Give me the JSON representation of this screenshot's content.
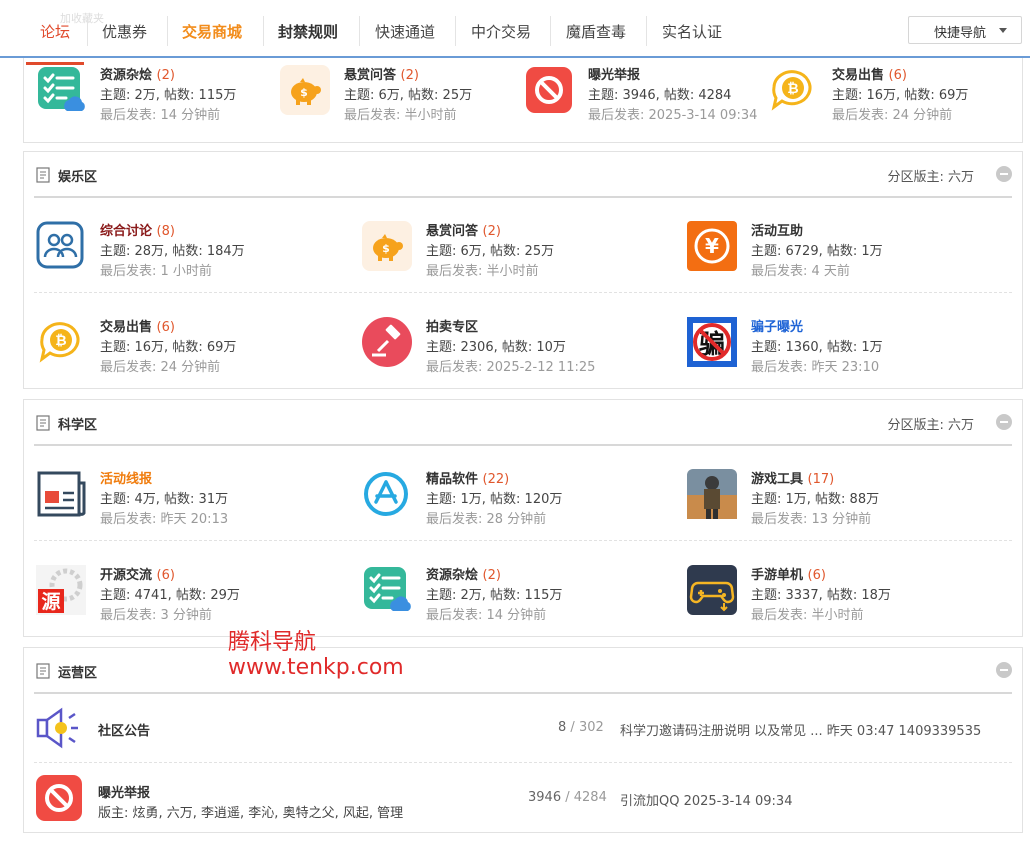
{
  "nav": {
    "hint": "加收藏夹",
    "items": [
      {
        "label": "论坛",
        "style": "active"
      },
      {
        "label": "优惠券",
        "style": ""
      },
      {
        "label": "交易商城",
        "style": "orange"
      },
      {
        "label": "封禁规则",
        "style": "bold"
      },
      {
        "label": "快速通道",
        "style": ""
      },
      {
        "label": "中介交易",
        "style": ""
      },
      {
        "label": "魔盾查毒",
        "style": ""
      },
      {
        "label": "实名认证",
        "style": ""
      }
    ],
    "quick_nav": "快捷导航"
  },
  "top_section": {
    "forums": [
      {
        "name": "资源杂烩",
        "count": "(2)",
        "stats": "主题: 2万, 帖数: 115万",
        "last": "最后发表: 14 分钟前",
        "icon": "checklist-cloud-icon"
      },
      {
        "name": "悬赏问答",
        "count": "(2)",
        "stats": "主题: 6万, 帖数: 25万",
        "last": "最后发表: 半小时前",
        "icon": "piggy-bank-icon"
      },
      {
        "name": "曝光举报",
        "count": "",
        "stats": "主题: 3946, 帖数: 4284",
        "last": "最后发表: 2025-3-14 09:34",
        "icon": "ban-icon"
      },
      {
        "name": "交易出售",
        "count": "(6)",
        "stats": "主题: 16万, 帖数: 69万",
        "last": "最后发表: 24 分钟前",
        "icon": "bitcoin-bubble-icon"
      }
    ]
  },
  "entertainment": {
    "title": "娱乐区",
    "moderator": "分区版主: 六万",
    "forums": [
      {
        "name": "综合讨论",
        "count": "(8)",
        "stats": "主题: 28万, 帖数: 184万",
        "last": "最后发表: 1 小时前",
        "icon": "group-discussion-icon",
        "color": "red"
      },
      {
        "name": "悬赏问答",
        "count": "(2)",
        "stats": "主题: 6万, 帖数: 25万",
        "last": "最后发表: 半小时前",
        "icon": "piggy-bank-icon",
        "color": ""
      },
      {
        "name": "活动互助",
        "count": "",
        "stats": "主题: 6729, 帖数: 1万",
        "last": "最后发表: 4 天前",
        "icon": "yen-coin-icon",
        "color": ""
      },
      {
        "name": "交易出售",
        "count": "(6)",
        "stats": "主题: 16万, 帖数: 69万",
        "last": "最后发表: 24 分钟前",
        "icon": "bitcoin-bubble-icon",
        "color": ""
      },
      {
        "name": "拍卖专区",
        "count": "",
        "stats": "主题: 2306, 帖数: 10万",
        "last": "最后发表: 2025-2-12 11:25",
        "icon": "auction-gavel-icon",
        "color": ""
      },
      {
        "name": "骗子曝光",
        "count": "",
        "stats": "主题: 1360, 帖数: 1万",
        "last": "最后发表: 昨天 23:10",
        "icon": "no-scam-icon",
        "color": "blue"
      }
    ]
  },
  "science": {
    "title": "科学区",
    "moderator": "分区版主: 六万",
    "forums": [
      {
        "name": "活动线报",
        "count": "",
        "stats": "主题: 4万, 帖数: 31万",
        "last": "最后发表: 昨天 20:13",
        "icon": "newspaper-icon",
        "color": "orange"
      },
      {
        "name": "精品软件",
        "count": "(22)",
        "stats": "主题: 1万, 帖数: 120万",
        "last": "最后发表: 28 分钟前",
        "icon": "app-store-icon",
        "color": ""
      },
      {
        "name": "游戏工具",
        "count": "(17)",
        "stats": "主题: 1万, 帖数: 88万",
        "last": "最后发表: 13 分钟前",
        "icon": "game-character-icon",
        "color": ""
      },
      {
        "name": "开源交流",
        "count": "(6)",
        "stats": "主题: 4741, 帖数: 29万",
        "last": "最后发表: 3 分钟前",
        "icon": "open-source-icon",
        "color": ""
      },
      {
        "name": "资源杂烩",
        "count": "(2)",
        "stats": "主题: 2万, 帖数: 115万",
        "last": "最后发表: 14 分钟前",
        "icon": "checklist-cloud-icon",
        "color": ""
      },
      {
        "name": "手游单机",
        "count": "(6)",
        "stats": "主题: 3337, 帖数: 18万",
        "last": "最后发表: 半小时前",
        "icon": "gamepad-icon",
        "color": ""
      }
    ]
  },
  "operations": {
    "title": "运营区",
    "rows": [
      {
        "name": "社区公告",
        "sub": "",
        "threads": "8",
        "posts": "302",
        "last": "科学刀邀请码注册说明 以及常见 ... 昨天 03:47 1409339535",
        "icon": "megaphone-icon"
      },
      {
        "name": "曝光举报",
        "sub": "版主: 炫勇, 六万, 李逍遥, 李沁, 奥特之父, 风起, 管理",
        "threads": "3946",
        "posts": "4284",
        "last": "引流加QQ 2025-3-14 09:34",
        "icon": "ban-icon"
      }
    ]
  },
  "watermark": {
    "line1": "腾科导航",
    "line2": "www.tenkp.com"
  },
  "colors": {
    "accent": "#e04a2c",
    "orange": "#f28c1b",
    "link_blue": "#1f64d6",
    "count": "#e0572d",
    "muted": "#9a9a9a"
  }
}
